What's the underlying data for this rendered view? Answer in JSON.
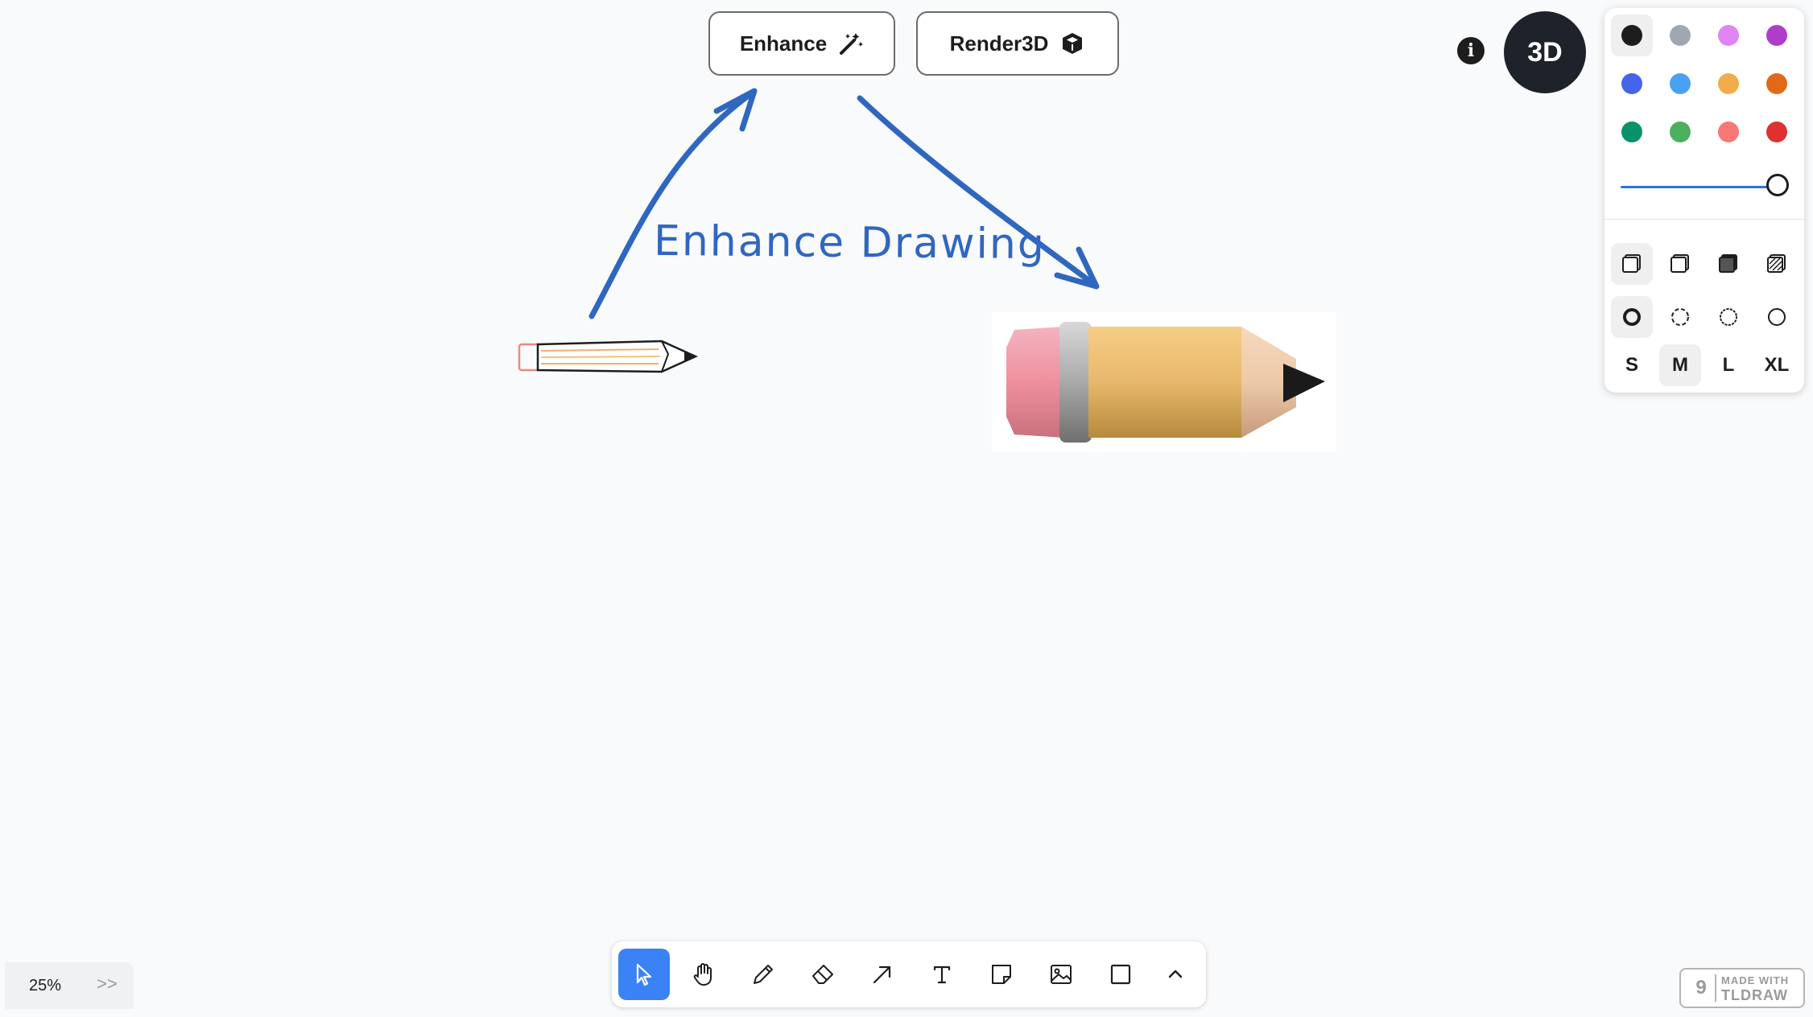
{
  "actions": {
    "enhance_label": "Enhance",
    "enhance_icon": "magic-wand-icon",
    "render_label": "Render3D",
    "render_icon": "cube-icon"
  },
  "info_icon": "info-icon",
  "three_d_label": "3D",
  "canvas": {
    "label": "Enhance Drawing",
    "label_color": "#2f67c0",
    "arrow_color": "#2f67c0"
  },
  "style_panel": {
    "colors": [
      "#1d1d1d",
      "#9fa8b2",
      "#e085f4",
      "#ae3ec9",
      "#4465e9",
      "#4ba1f1",
      "#f1ac4b",
      "#e16919",
      "#099268",
      "#4cb05e",
      "#f87777",
      "#e03131"
    ],
    "selected_color_index": 0,
    "opacity": 1.0,
    "fill_icons": [
      "fill-none-icon",
      "fill-semi-icon",
      "fill-solid-icon",
      "fill-pattern-icon"
    ],
    "dash_icons": [
      "dash-draw-icon",
      "dash-dashed-icon",
      "dash-dotted-icon",
      "dash-solid-icon"
    ],
    "sizes": [
      "S",
      "M",
      "L",
      "XL"
    ],
    "selected_size": "M"
  },
  "toolbar": {
    "tools": [
      "select-tool",
      "hand-tool",
      "draw-tool",
      "eraser-tool",
      "arrow-tool",
      "text-tool",
      "note-tool",
      "image-tool",
      "rectangle-tool",
      "more-tools"
    ],
    "selected_tool": "select-tool",
    "accent": "#3b82f6"
  },
  "zoom": {
    "label": "25%",
    "expand_label": ">>"
  },
  "badge": {
    "line1": "MADE WITH",
    "line2": "TLDRAW"
  }
}
